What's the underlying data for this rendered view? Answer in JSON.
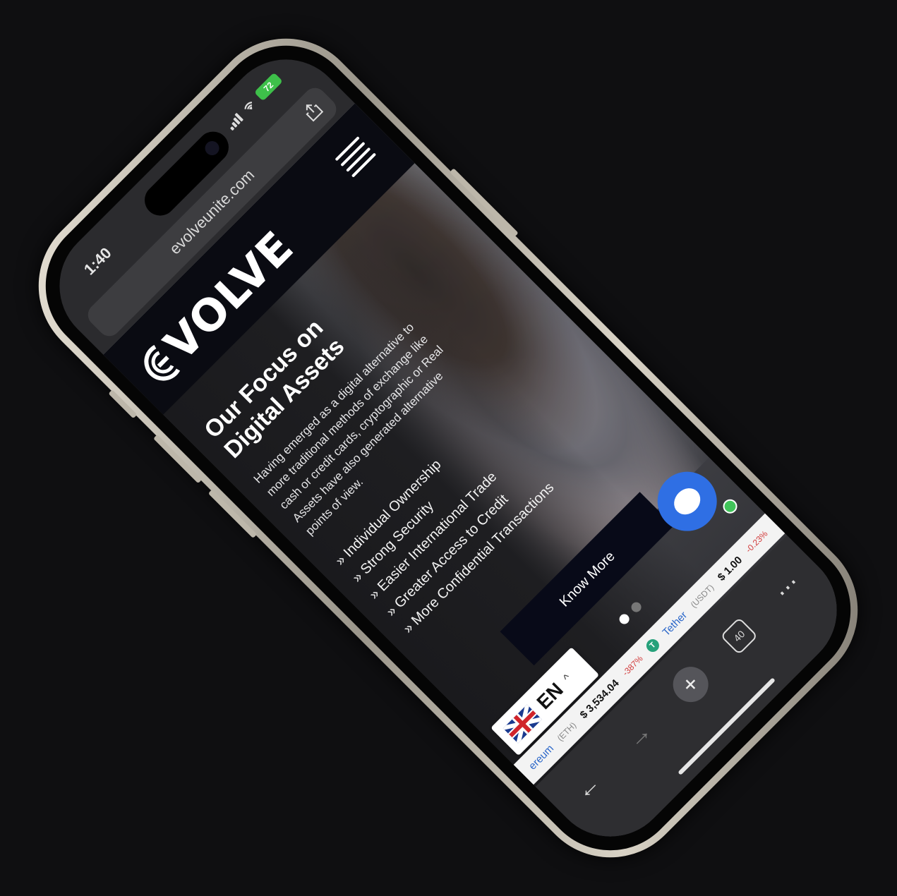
{
  "status_bar": {
    "time": "1:40",
    "battery": "72"
  },
  "browser": {
    "url": "evolveunite.com"
  },
  "site": {
    "logo": "VOLVE",
    "hero": {
      "title": "Our Focus on Digital Assets",
      "text": "Having emerged as a digital alternative to more traditional methods of exchange like cash or credit cards, cryptographic or Real Assets have also generated alternative points of view.",
      "bullets": [
        "» Individual Ownership",
        "» Strong Security",
        "» Easier International Trade",
        "» Greater Access to Credit",
        "» More Confidential Transactions"
      ],
      "cta_label": "Know More"
    }
  },
  "ticker": [
    {
      "name": "ereum",
      "symbol": "(ETH)",
      "price": "$ 3,534.04",
      "change": "-387%"
    },
    {
      "name": "Tether",
      "symbol": "(USDT)",
      "price": "$ 1.00",
      "change": "-0.23%"
    }
  ],
  "language": {
    "code": "EN"
  },
  "toolbar": {
    "tab_count": "40"
  },
  "colors": {
    "chat_button": "#2f6fe4",
    "battery": "#3ec04a",
    "cta_bg": "#080a18"
  }
}
